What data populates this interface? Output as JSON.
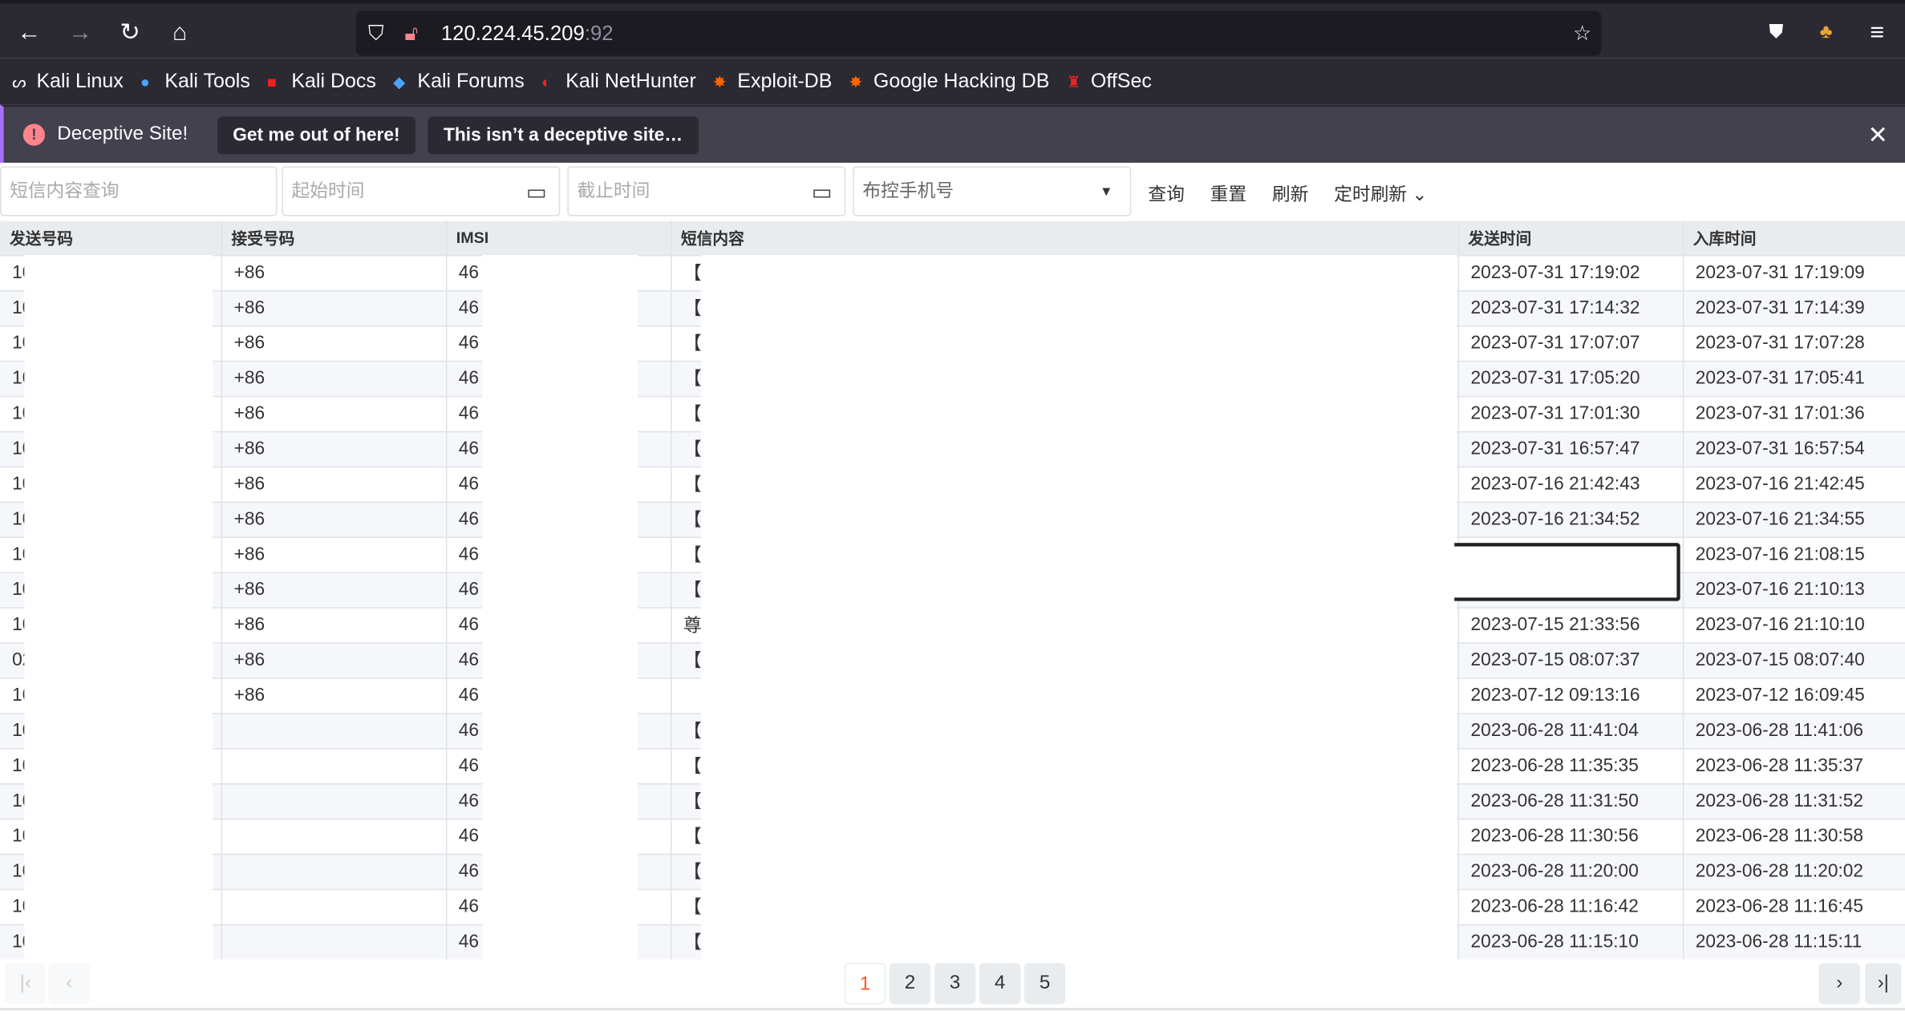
{
  "browser": {
    "url_host": "120.224.45.209",
    "url_port": ":92",
    "bookmarks": [
      "Kali Linux",
      "Kali Tools",
      "Kali Docs",
      "Kali Forums",
      "Kali NetHunter",
      "Exploit-DB",
      "Google Hacking DB",
      "OffSec"
    ]
  },
  "warning": {
    "title": "Deceptive Site!",
    "leave": "Get me out of here!",
    "ignore": "This isn’t a deceptive site…"
  },
  "filters": {
    "content_placeholder": "短信内容查询",
    "start_placeholder": "起始时间",
    "end_placeholder": "截止时间",
    "phone_select": "布控手机号",
    "query": "查询",
    "reset": "重置",
    "refresh": "刷新",
    "auto_refresh": "定时刷新"
  },
  "table": {
    "headers": [
      "发送号码",
      "接受号码",
      "IMSI",
      "短信内容",
      "发送时间",
      "入库时间"
    ],
    "rows": [
      [
        "10",
        "+86",
        "46",
        "【",
        "2023-07-31 17:19:02",
        "2023-07-31 17:19:09"
      ],
      [
        "10",
        "+86",
        "46",
        "【",
        "2023-07-31 17:14:32",
        "2023-07-31 17:14:39"
      ],
      [
        "10",
        "+86",
        "46",
        "【",
        "2023-07-31 17:07:07",
        "2023-07-31 17:07:28"
      ],
      [
        "10",
        "+86",
        "46",
        "【",
        "2023-07-31 17:05:20",
        "2023-07-31 17:05:41"
      ],
      [
        "10",
        "+86",
        "46",
        "【",
        "2023-07-31 17:01:30",
        "2023-07-31 17:01:36"
      ],
      [
        "10",
        "+86",
        "46",
        "【",
        "2023-07-31 16:57:47",
        "2023-07-31 16:57:54"
      ],
      [
        "10",
        "+86",
        "46",
        "【",
        "2023-07-16 21:42:43",
        "2023-07-16 21:42:45"
      ],
      [
        "10",
        "+86",
        "46",
        "【",
        "2023-07-16 21:34:52",
        "2023-07-16 21:34:55"
      ],
      [
        "10",
        "+86",
        "46",
        "【",
        "",
        "2023-07-16 21:08:15"
      ],
      [
        "10",
        "+86",
        "46",
        "【",
        "",
        "2023-07-16 21:10:13"
      ],
      [
        "10",
        "+86",
        "46",
        "尊",
        "2023-07-15 21:33:56",
        "2023-07-16 21:10:10"
      ],
      [
        "02",
        "+86",
        "46",
        "【",
        "2023-07-15 08:07:37",
        "2023-07-15 08:07:40"
      ],
      [
        "10",
        "+86",
        "46",
        "",
        "2023-07-12 09:13:16",
        "2023-07-12 16:09:45"
      ],
      [
        "10",
        "",
        "46",
        "【",
        "2023-06-28 11:41:04",
        "2023-06-28 11:41:06"
      ],
      [
        "10",
        "",
        "46",
        "【",
        "2023-06-28 11:35:35",
        "2023-06-28 11:35:37"
      ],
      [
        "10",
        "",
        "46",
        "【",
        "2023-06-28 11:31:50",
        "2023-06-28 11:31:52"
      ],
      [
        "10",
        "",
        "46",
        "【",
        "2023-06-28 11:30:56",
        "2023-06-28 11:30:58"
      ],
      [
        "10",
        "",
        "46",
        "【",
        "2023-06-28 11:20:00",
        "2023-06-28 11:20:02"
      ],
      [
        "10",
        "",
        "46",
        "【",
        "2023-06-28 11:16:42",
        "2023-06-28 11:16:45"
      ],
      [
        "10",
        "",
        "46",
        "【",
        "2023-06-28 11:15:10",
        "2023-06-28 11:15:11"
      ]
    ]
  },
  "pagination": {
    "pages": [
      "1",
      "2",
      "3",
      "4",
      "5"
    ],
    "current": "1",
    "accent": "#ff5722",
    "first": "|‹",
    "prev": "‹",
    "next": "›",
    "last": "›|"
  }
}
